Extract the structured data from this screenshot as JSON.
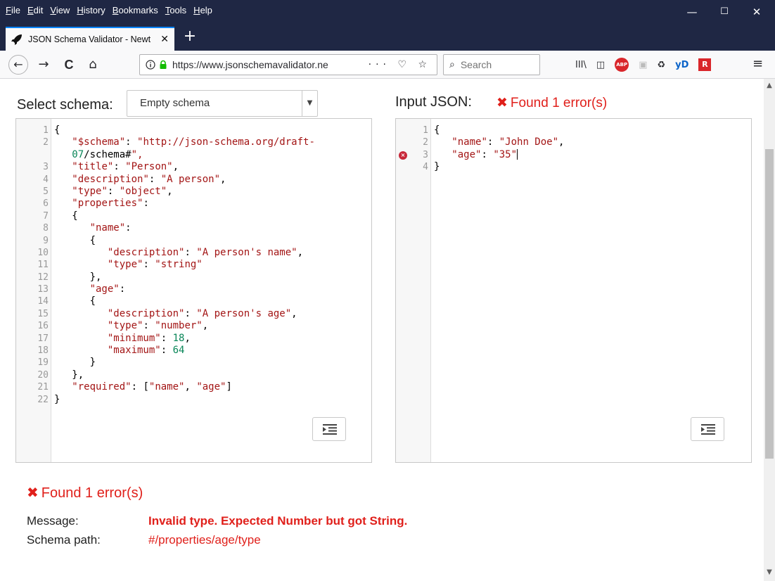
{
  "menu": {
    "items": [
      "File",
      "Edit",
      "View",
      "History",
      "Bookmarks",
      "Tools",
      "Help"
    ]
  },
  "window_controls": {
    "minimize": "—",
    "maximize": "☐",
    "close": "✕"
  },
  "tab": {
    "title": "JSON Schema Validator - Newt",
    "close": "✕",
    "new_tab": "+"
  },
  "nav": {
    "back": "←",
    "forward": "→",
    "reload": "C",
    "home": "⌂",
    "url": "https://www.jsonschemavalidator.ne",
    "page_actions": "··· ♡ ☆",
    "search_placeholder": "Search",
    "menu": "≡"
  },
  "toolbar_icons": {
    "library": "III\\",
    "sidebar": "◫",
    "abp": "ABP",
    "reader": "▣",
    "ext": "♻",
    "yd": "yD",
    "red_ext": "R"
  },
  "schema_panel": {
    "label": "Select schema:",
    "selected": "Empty schema"
  },
  "input_panel": {
    "label": "Input JSON:",
    "error_count": "Found 1 error(s)"
  },
  "schema_code": [
    {
      "n": "1",
      "t": "{"
    },
    {
      "n": "2",
      "t": "   \"$schema\": \"http://json-schema.org/draft-"
    },
    {
      "n": "",
      "t": "   07/schema#\","
    },
    {
      "n": "3",
      "t": "   \"title\": \"Person\","
    },
    {
      "n": "4",
      "t": "   \"description\": \"A person\","
    },
    {
      "n": "5",
      "t": "   \"type\": \"object\","
    },
    {
      "n": "6",
      "t": "   \"properties\":"
    },
    {
      "n": "7",
      "t": "   {"
    },
    {
      "n": "8",
      "t": "      \"name\":"
    },
    {
      "n": "9",
      "t": "      {"
    },
    {
      "n": "10",
      "t": "         \"description\": \"A person's name\","
    },
    {
      "n": "11",
      "t": "         \"type\": \"string\""
    },
    {
      "n": "12",
      "t": "      },"
    },
    {
      "n": "13",
      "t": "      \"age\":"
    },
    {
      "n": "14",
      "t": "      {"
    },
    {
      "n": "15",
      "t": "         \"description\": \"A person's age\","
    },
    {
      "n": "16",
      "t": "         \"type\": \"number\","
    },
    {
      "n": "17",
      "t": "         \"minimum\": 18,"
    },
    {
      "n": "18",
      "t": "         \"maximum\": 64"
    },
    {
      "n": "19",
      "t": "      }"
    },
    {
      "n": "20",
      "t": "   },"
    },
    {
      "n": "21",
      "t": "   \"required\": [\"name\", \"age\"]"
    },
    {
      "n": "22",
      "t": "}"
    }
  ],
  "input_code": [
    {
      "n": "1",
      "t": "{"
    },
    {
      "n": "2",
      "t": "   \"name\": \"John Doe\","
    },
    {
      "n": "3",
      "t": "   \"age\": \"35\"",
      "error": true
    },
    {
      "n": "4",
      "t": "}"
    }
  ],
  "result": {
    "title": "Found 1 error(s)",
    "message_label": "Message:",
    "message": "Invalid type. Expected Number but got String.",
    "path_label": "Schema path:",
    "path": "#/properties/age/type"
  },
  "colors": {
    "error": "#e0201b",
    "titlebar": "#1f2744",
    "string": "#a31515",
    "number": "#098658"
  }
}
